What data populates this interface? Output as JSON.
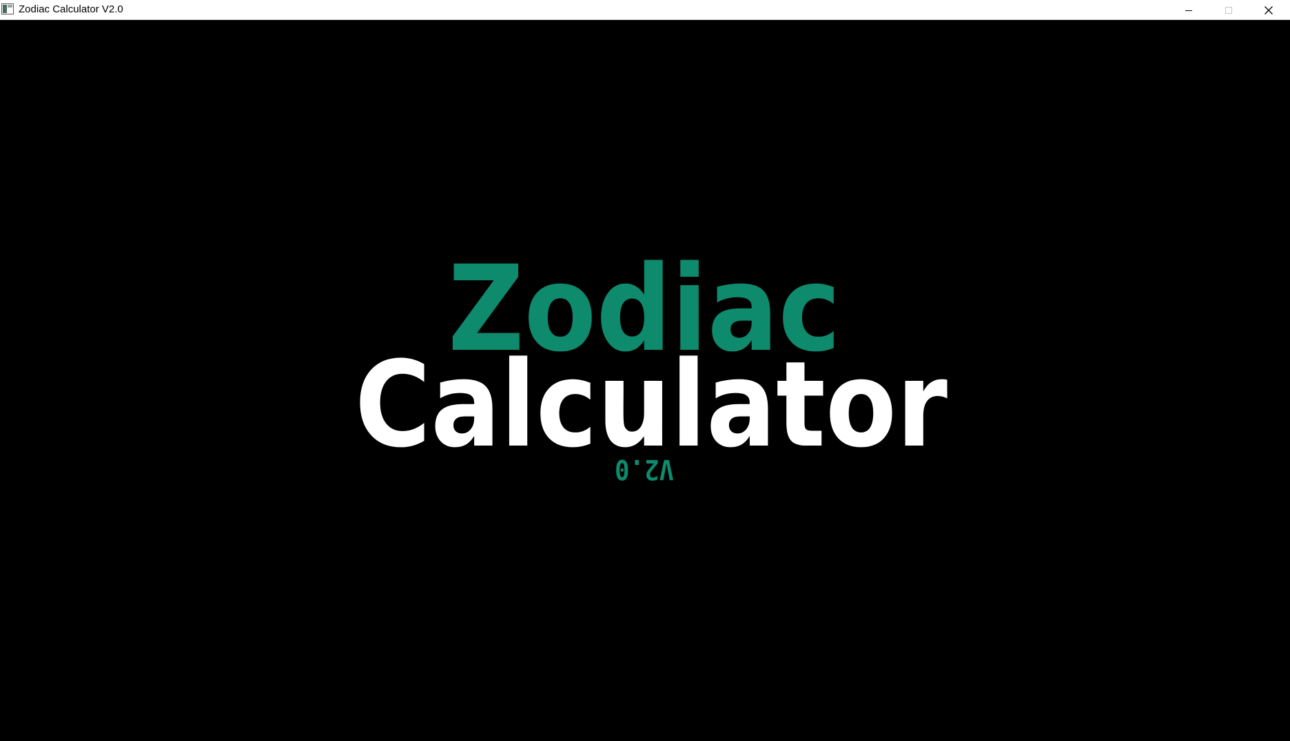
{
  "window": {
    "title": "Zodiac Calculator V2.0"
  },
  "controls": {
    "minimize_icon": "minimize-icon",
    "maximize_icon": "maximize-icon",
    "close_icon": "close-icon"
  },
  "splash": {
    "word1": "Zodiac",
    "word2": "Calculator",
    "version": "V2.0",
    "colors": {
      "accent": "#0e8a6c",
      "primary": "#ffffff",
      "background": "#000000"
    }
  }
}
